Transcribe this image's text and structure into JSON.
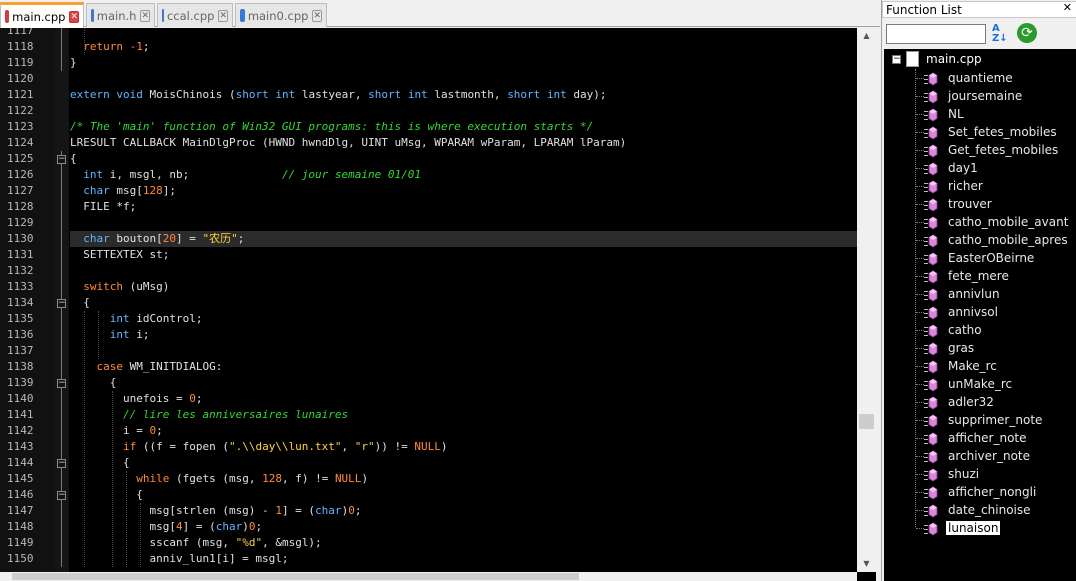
{
  "tabs": [
    {
      "label": "main.cpp",
      "active": true,
      "icon": "red-floppy-icon"
    },
    {
      "label": "main.h",
      "active": false,
      "icon": "blue-floppy-icon"
    },
    {
      "label": "ccal.cpp",
      "active": false,
      "icon": "blue-floppy-icon"
    },
    {
      "label": "main0.cpp",
      "active": false,
      "icon": "blue-floppy-icon"
    }
  ],
  "editor": {
    "current_line": 1130,
    "lines": [
      {
        "n": "1117",
        "html": ""
      },
      {
        "n": "1118",
        "html": "  <span class=\"kw\">return</span> <span class=\"num\">-1</span>;"
      },
      {
        "n": "1119",
        "html": "}"
      },
      {
        "n": "1120",
        "html": ""
      },
      {
        "n": "1121",
        "html": "<span class=\"ty\">extern</span> <span class=\"ty\">void</span> MoisChinois (<span class=\"ty\">short</span> <span class=\"ty\">int</span> lastyear, <span class=\"ty\">short</span> <span class=\"ty\">int</span> lastmonth, <span class=\"ty\">short</span> <span class=\"ty\">int</span> day);"
      },
      {
        "n": "1122",
        "html": ""
      },
      {
        "n": "1123",
        "html": "<span class=\"cm\">/* The 'main' function of Win32 GUI programs: this is where execution starts */</span>"
      },
      {
        "n": "1124",
        "html": "LRESULT CALLBACK MainDlgProc (HWND hwndDlg, UINT uMsg, WPARAM wParam, LPARAM lParam)"
      },
      {
        "n": "1125",
        "html": "{"
      },
      {
        "n": "1126",
        "html": "  <span class=\"ty\">int</span> i, msgl, nb;              <span class=\"cm\">// jour semaine 01/01</span>"
      },
      {
        "n": "1127",
        "html": "  <span class=\"ty\">char</span> msg[<span class=\"num\">128</span>];"
      },
      {
        "n": "1128",
        "html": "  FILE *f;"
      },
      {
        "n": "1129",
        "html": ""
      },
      {
        "n": "1130",
        "html": "  <span class=\"ty\">char</span> bouton[<span class=\"num\">20</span>] = <span class=\"str\">\"农历\"</span>;"
      },
      {
        "n": "1131",
        "html": "  SETTEXTEX st;"
      },
      {
        "n": "1132",
        "html": ""
      },
      {
        "n": "1133",
        "html": "  <span class=\"kw\">switch</span> (uMsg)"
      },
      {
        "n": "1134",
        "html": "  {"
      },
      {
        "n": "1135",
        "html": "      <span class=\"ty\">int</span> idControl;"
      },
      {
        "n": "1136",
        "html": "      <span class=\"ty\">int</span> i;"
      },
      {
        "n": "1137",
        "html": ""
      },
      {
        "n": "1138",
        "html": "    <span class=\"kw\">case</span> WM_INITDIALOG:"
      },
      {
        "n": "1139",
        "html": "      {"
      },
      {
        "n": "1140",
        "html": "        unefois = <span class=\"num\">0</span>;"
      },
      {
        "n": "1141",
        "html": "        <span class=\"cm\">// lire les anniversaires lunaires</span>"
      },
      {
        "n": "1142",
        "html": "        i = <span class=\"num\">0</span>;"
      },
      {
        "n": "1143",
        "html": "        <span class=\"kw\">if</span> ((f = fopen (<span class=\"str\">\".\\\\day\\\\lun.txt\"</span>, <span class=\"str\">\"r\"</span>)) != <span class=\"num\">NULL</span>)"
      },
      {
        "n": "1144",
        "html": "        {"
      },
      {
        "n": "1145",
        "html": "          <span class=\"kw\">while</span> (fgets (msg, <span class=\"num\">128</span>, f) != <span class=\"num\">NULL</span>)"
      },
      {
        "n": "1146",
        "html": "          {"
      },
      {
        "n": "1147",
        "html": "            msg[strlen (msg) - <span class=\"num\">1</span>] = (<span class=\"ty\">char</span>)<span class=\"num\">0</span>;"
      },
      {
        "n": "1148",
        "html": "            msg[<span class=\"num\">4</span>] = (<span class=\"ty\">char</span>)<span class=\"num\">0</span>;"
      },
      {
        "n": "1149",
        "html": "            sscanf (msg, <span class=\"str\">\"%d\"</span>, &amp;msgl);"
      },
      {
        "n": "1150",
        "html": "            anniv_lun1[i] = msgl;"
      }
    ]
  },
  "function_list": {
    "title": "Function List",
    "close_label": "✕",
    "search_value": "",
    "sort_icon": "sort-az-icon",
    "reload_icon": "reload-icon",
    "root": "main.cpp",
    "selected": "lunaison",
    "items": [
      "quantieme",
      "joursemaine",
      "NL",
      "Set_fetes_mobiles",
      "Get_fetes_mobiles",
      "day1",
      "richer",
      "trouver",
      "catho_mobile_avant",
      "catho_mobile_apres",
      "EasterOBeirne",
      "fete_mere",
      "annivlun",
      "annivsol",
      "catho",
      "gras",
      "Make_rc",
      "unMake_rc",
      "adler32",
      "supprimer_note",
      "afficher_note",
      "archiver_note",
      "shuzi",
      "afficher_nongli",
      "date_chinoise",
      "lunaison"
    ]
  }
}
